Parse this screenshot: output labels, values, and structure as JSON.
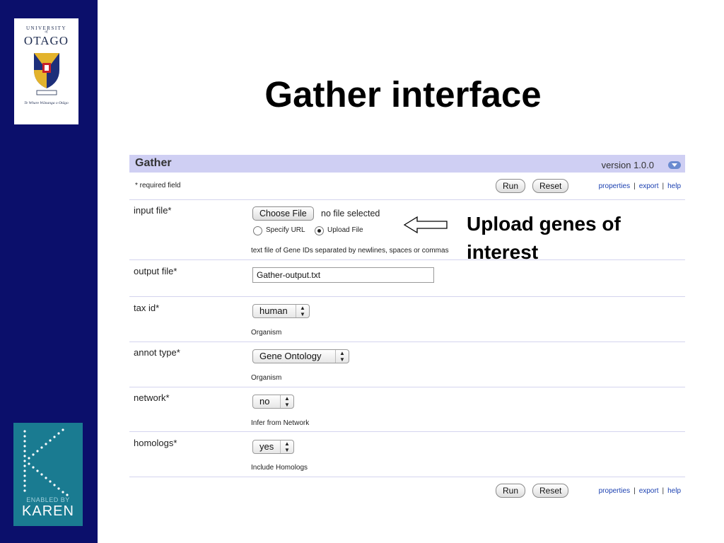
{
  "sidebar": {
    "logo": {
      "university": "UNIVERSITY",
      "of": "of",
      "name": "OTAGO",
      "motto": "Te Whare Wānanga o Otāgo",
      "crest_icon": "otago-crest-icon"
    },
    "karen": {
      "enabled_by": "ENABLED BY",
      "name": "KAREN",
      "icon": "karen-k-dots-icon"
    }
  },
  "slide": {
    "title": "Gather interface"
  },
  "form": {
    "name": "Gather",
    "version": "version 1.0.0",
    "required_note": "* required field",
    "run_label": "Run",
    "reset_label": "Reset",
    "links": [
      "properties",
      "export",
      "help"
    ],
    "fields": {
      "input_file": {
        "label": "input file*",
        "choose_button": "Choose File",
        "file_status": "no file selected",
        "radio_url": "Specify URL",
        "radio_upload": "Upload File",
        "help": "text file of Gene IDs separated by newlines, spaces or commas"
      },
      "output_file": {
        "label": "output file*",
        "value": "Gather-output.txt"
      },
      "tax_id": {
        "label": "tax id*",
        "value": "human",
        "help": "Organism"
      },
      "annot_type": {
        "label": "annot type*",
        "value": "Gene Ontology",
        "help": "Organism"
      },
      "network": {
        "label": "network*",
        "value": "no",
        "help": "Infer from Network"
      },
      "homologs": {
        "label": "homologs*",
        "value": "yes",
        "help": "Include Homologs"
      }
    }
  },
  "annotation": {
    "text": "Upload genes of interest"
  },
  "colors": {
    "sidebar": "#0b0f6b",
    "header": "#cfcff3",
    "link": "#1a3fb0",
    "karen": "#1a7b91"
  }
}
